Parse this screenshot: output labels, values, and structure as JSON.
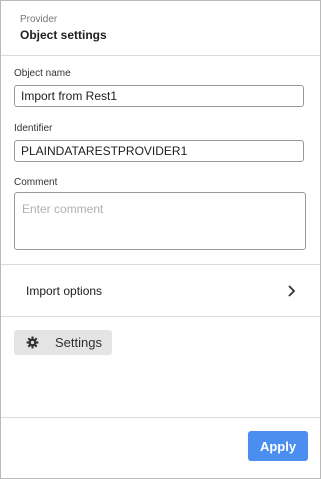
{
  "header": {
    "subtitle": "Provider",
    "title": "Object settings"
  },
  "form": {
    "object_name": {
      "label": "Object name",
      "value": "Import from Rest1"
    },
    "identifier": {
      "label": "Identifier",
      "value": "PLAINDATARESTPROVIDER1"
    },
    "comment": {
      "label": "Comment",
      "value": "",
      "placeholder": "Enter comment"
    }
  },
  "import_options": {
    "label": "Import options",
    "icon": "chevron-right-icon"
  },
  "settings_button": {
    "label": "Settings",
    "icon": "gear-icon"
  },
  "apply_button": {
    "label": "Apply"
  },
  "colors": {
    "accent": "#4c8df0",
    "button_secondary": "#e4e4e4",
    "border": "#9a9a9a"
  }
}
